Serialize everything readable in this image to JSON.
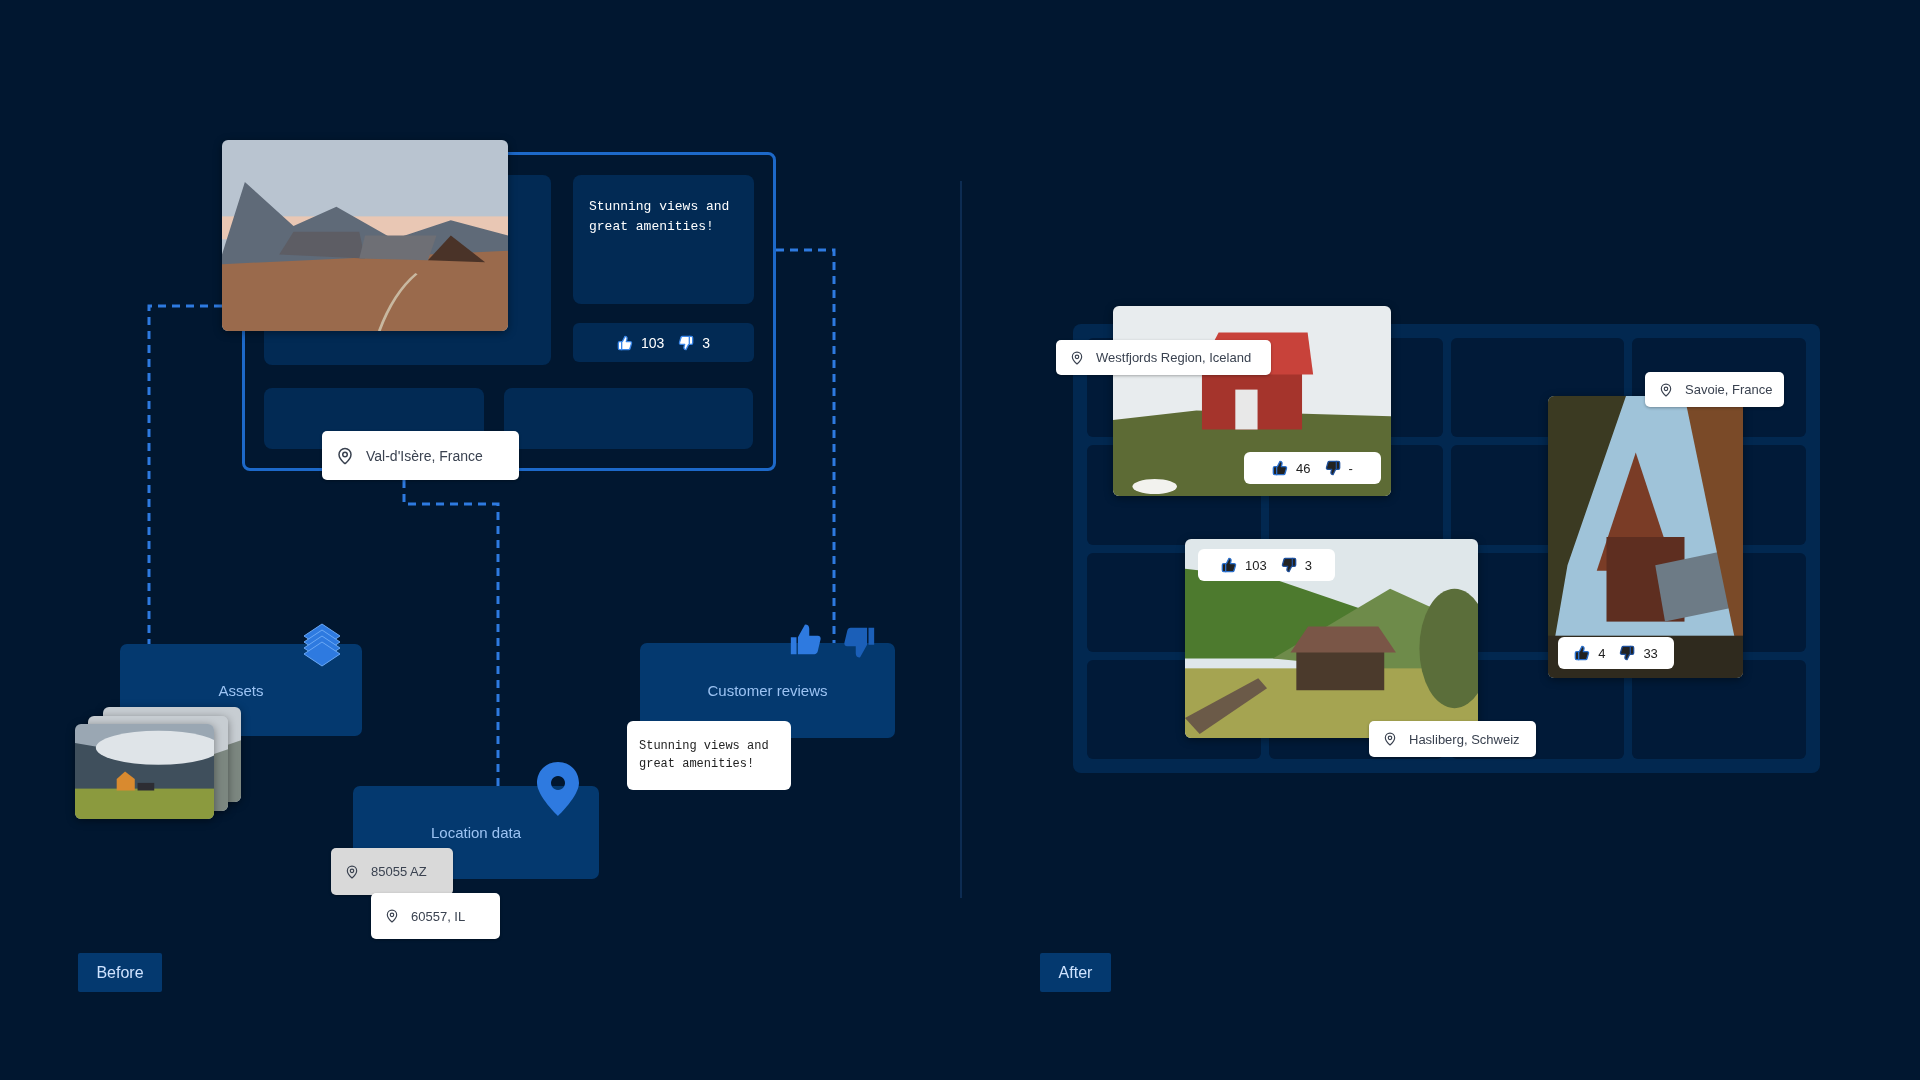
{
  "before": {
    "listing": {
      "review": "Stunning views and great amenities!",
      "likes": "103",
      "dislikes": "3",
      "location": "Val-d'Isère, France"
    },
    "sources": [
      {
        "kind": "assets",
        "label": "Assets"
      },
      {
        "kind": "location",
        "label": "Location data",
        "locations": [
          "85055 AZ",
          "60557, IL"
        ]
      },
      {
        "kind": "reviews",
        "label": "Customer reviews",
        "review": "Stunning views and great amenities!"
      }
    ],
    "tag": "Before"
  },
  "after": {
    "tag": "After",
    "listings": [
      {
        "location": "Westfjords Region, Iceland",
        "likes": "46",
        "dislikes": "-"
      },
      {
        "location": "Hasliberg, Schweiz",
        "likes": "103",
        "dislikes": "3"
      },
      {
        "location": "Savoie, France",
        "likes": "4",
        "dislikes": "33"
      }
    ]
  }
}
